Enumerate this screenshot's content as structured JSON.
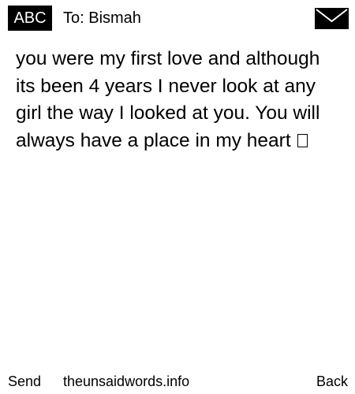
{
  "header": {
    "badge": "ABC",
    "to_text": "To: Bismah",
    "mail_icon": "envelope-icon"
  },
  "message": {
    "body": "you were my first love and although its been 4 years I never look at any girl the way I looked at you. You will always have a place in my heart",
    "trailing_glyph": "missing-emoji-box"
  },
  "footer": {
    "send": "Send",
    "site": "theunsaidwords.info",
    "back": "Back"
  },
  "colors": {
    "background": "#ffffff",
    "text": "#000000",
    "badge_bg": "#000000",
    "badge_text": "#ffffff"
  }
}
